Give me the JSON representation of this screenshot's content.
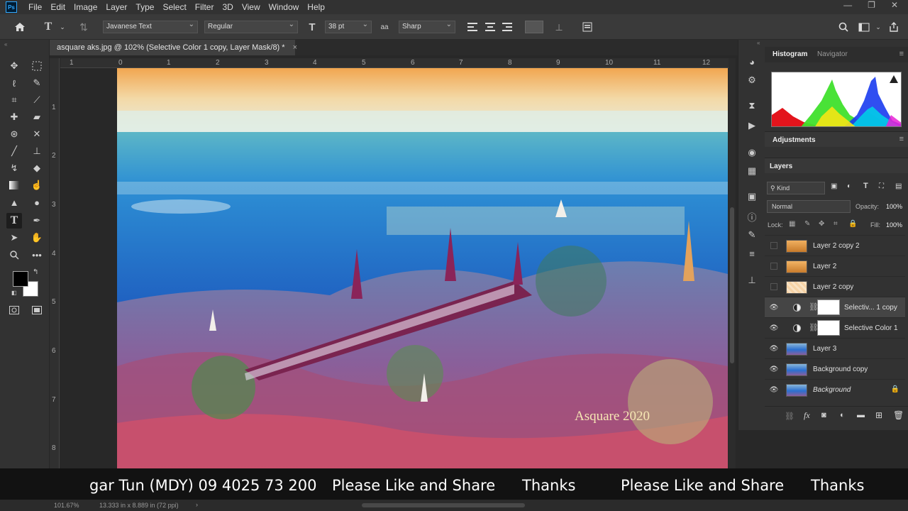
{
  "menubar": {
    "app_badge": "Ps",
    "items": [
      "File",
      "Edit",
      "Image",
      "Layer",
      "Type",
      "Select",
      "Filter",
      "3D",
      "View",
      "Window",
      "Help"
    ],
    "window_controls": [
      "—",
      "❐",
      "✕"
    ]
  },
  "options": {
    "font_family": "Javanese Text",
    "font_style": "Regular",
    "font_size": "38 pt",
    "antialias": "Sharp"
  },
  "document": {
    "tab_title": "asquare aks.jpg @ 102% (Selective Color 1 copy, Layer Mask/8) *",
    "tab_close": "×",
    "watermark": "Asquare 2020"
  },
  "rulers": {
    "top": [
      "1",
      "0",
      "1",
      "2",
      "3",
      "4",
      "5",
      "6",
      "7",
      "8",
      "9",
      "10",
      "11",
      "12"
    ],
    "left": [
      "1",
      "2",
      "3",
      "4",
      "5",
      "6",
      "7",
      "8"
    ]
  },
  "panels": {
    "histogram_tab": "Histogram",
    "navigator_tab": "Navigator",
    "adjustments_tab": "Adjustments",
    "layers_tab": "Layers",
    "filter_kind": "Kind",
    "blend_mode": "Normal",
    "opacity_label": "Opacity:",
    "opacity_value": "100%",
    "lock_label": "Lock:",
    "fill_label": "Fill:",
    "fill_value": "100%"
  },
  "layers": [
    {
      "name": "Layer 2 copy 2",
      "visible": false,
      "kind": "pixel",
      "thumb": "orange"
    },
    {
      "name": "Layer 2",
      "visible": false,
      "kind": "pixel",
      "thumb": "orange"
    },
    {
      "name": "Layer 2 copy",
      "visible": false,
      "kind": "pixel",
      "thumb": "peach"
    },
    {
      "name": "Selectiv... 1 copy",
      "visible": true,
      "kind": "adjustment",
      "selected": true
    },
    {
      "name": "Selective Color 1",
      "visible": true,
      "kind": "adjustment"
    },
    {
      "name": "Layer 3",
      "visible": true,
      "kind": "pixel",
      "thumb": "photo"
    },
    {
      "name": "Background copy",
      "visible": true,
      "kind": "pixel",
      "thumb": "photo"
    },
    {
      "name": "Background",
      "visible": true,
      "kind": "pixel",
      "thumb": "photo",
      "locked": true
    }
  ],
  "ticker": {
    "items": [
      "gar Tun (MDY) 09 4025 73 200",
      "Please Like and Share",
      "Thanks",
      "Please Like and Share",
      "Thanks"
    ]
  },
  "status": {
    "zoom": "101.67%",
    "dimensions": "13.333 in x 8.889 in (72 ppi)"
  }
}
